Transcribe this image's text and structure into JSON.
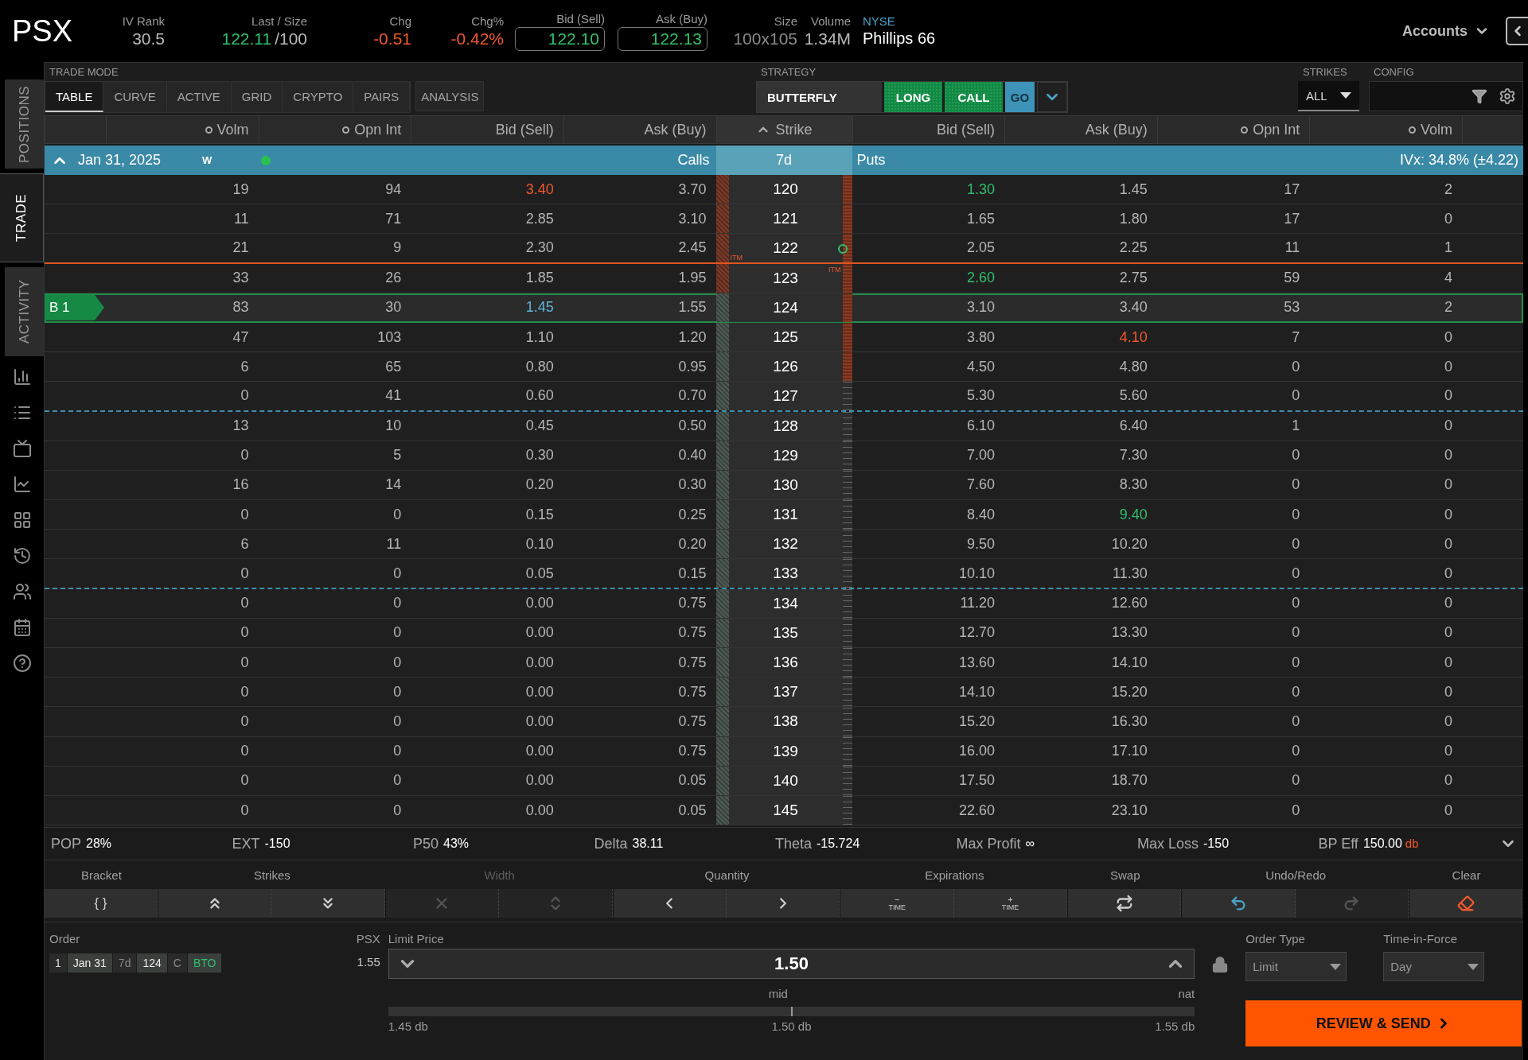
{
  "header": {
    "symbol": "PSX",
    "quotes": [
      {
        "label": "IV Rank",
        "value": "30.5",
        "color": "#b8b8b8",
        "kind": "plain"
      },
      {
        "label": "Last / Size",
        "value": "122.11",
        "suffix": "/100",
        "color": "#2fbf6c",
        "kind": "plain"
      },
      {
        "label": "Chg",
        "value": "-0.51",
        "color": "#f0582e",
        "kind": "plain"
      },
      {
        "label": "Chg%",
        "value": "-0.42%",
        "color": "#f0582e",
        "kind": "plain"
      },
      {
        "label": "Bid (Sell)",
        "value": "122.10",
        "color": "#2fbf6c",
        "kind": "boxed"
      },
      {
        "label": "Ask (Buy)",
        "value": "122.13",
        "color": "#2fbf6c",
        "kind": "boxed"
      },
      {
        "label": "Size",
        "value": "100x105",
        "color": "#8a8a8a",
        "kind": "plain"
      },
      {
        "label": "Volume",
        "value": "1.34M",
        "color": "#b8b8b8",
        "kind": "plain"
      }
    ],
    "exchange": "NYSE",
    "company": "Phillips 66",
    "accounts": "Accounts"
  },
  "sidebar": {
    "tabs": [
      {
        "label": "POSITIONS",
        "selected": false
      },
      {
        "label": "TRADE",
        "selected": true
      },
      {
        "label": "ACTIVITY",
        "selected": false
      }
    ],
    "tools": [
      {
        "kind": "report"
      },
      {
        "kind": "list"
      },
      {
        "kind": "tv"
      },
      {
        "kind": "chart"
      },
      {
        "kind": "grid"
      },
      {
        "kind": "history"
      },
      {
        "kind": "people"
      },
      {
        "kind": "calendar"
      },
      {
        "kind": "help"
      }
    ]
  },
  "trade_mode": {
    "label": "TRADE MODE",
    "tabs": [
      {
        "label": "TABLE",
        "selected": true
      },
      {
        "label": "CURVE",
        "selected": false
      },
      {
        "label": "ACTIVE",
        "selected": false
      },
      {
        "label": "GRID",
        "selected": false
      },
      {
        "label": "CRYPTO",
        "selected": false
      },
      {
        "label": "PAIRS",
        "selected": false
      }
    ],
    "analysis": "ANALYSIS"
  },
  "strategy": {
    "label": "STRATEGY",
    "name": "BUTTERFLY",
    "direction": "LONG",
    "type": "CALL",
    "go": "GO"
  },
  "strikes": {
    "label": "STRIKES",
    "value": "ALL"
  },
  "config": {
    "label": "CONFIG"
  },
  "columns": {
    "calls": [
      {
        "label": "Volm",
        "kind": "toggle"
      },
      {
        "label": "Opn Int",
        "kind": "toggle"
      },
      {
        "label": "Bid (Sell)",
        "kind": "plain"
      },
      {
        "label": "Ask (Buy)",
        "kind": "plain"
      }
    ],
    "strike": "Strike",
    "puts": [
      {
        "label": "Bid (Sell)",
        "kind": "plain"
      },
      {
        "label": "Ask (Buy)",
        "kind": "plain"
      },
      {
        "label": "Opn Int",
        "kind": "toggle"
      },
      {
        "label": "Volm",
        "kind": "toggle"
      }
    ]
  },
  "expiry": {
    "date": "Jan 31, 2025",
    "tag": "W",
    "expanded": true,
    "calls": "Calls",
    "days": "7d",
    "puts": "Puts",
    "ivx": "IVx: 34.8% (±4.22)"
  },
  "rows": [
    {
      "strike": "120",
      "call": [
        "19",
        "94",
        {
          "value": "3.40",
          "color": "#f0582e"
        },
        "3.70"
      ],
      "put": [
        {
          "value": "1.30",
          "color": "#2fbf6c"
        },
        "1.45",
        "17",
        "2"
      ],
      "call_itm": true,
      "put_bar": true,
      "selected": false
    },
    {
      "strike": "121",
      "call": [
        "11",
        "71",
        "2.85",
        "3.10"
      ],
      "put": [
        "1.65",
        "1.80",
        "17",
        "0"
      ],
      "call_itm": true,
      "put_bar": true,
      "selected": false
    },
    {
      "strike": "122",
      "call": [
        "21",
        "9",
        "2.30",
        "2.45"
      ],
      "put": [
        "2.05",
        "2.25",
        "11",
        "1"
      ],
      "call_itm": true,
      "put_bar": true,
      "selected": false,
      "itm_line_below": true,
      "call_itm_label": "ITM",
      "marker": true
    },
    {
      "strike": "123",
      "call": [
        "33",
        "26",
        "1.85",
        "1.95"
      ],
      "put": [
        {
          "value": "2.60",
          "color": "#2fbf6c"
        },
        "2.75",
        "59",
        "4"
      ],
      "call_itm": true,
      "put_bar": true,
      "selected": false,
      "put_itm_label": "ITM"
    },
    {
      "strike": "124",
      "call": [
        "83",
        "30",
        {
          "value": "1.45",
          "color": "#5fb4d6"
        },
        "1.55"
      ],
      "put": [
        "3.10",
        "3.40",
        "53",
        "2"
      ],
      "call_itm": false,
      "put_bar": true,
      "selected": true,
      "position": "B 1"
    },
    {
      "strike": "125",
      "call": [
        "47",
        "103",
        "1.10",
        "1.20"
      ],
      "put": [
        "3.80",
        {
          "value": "4.10",
          "color": "#f0582e"
        },
        "7",
        "0"
      ],
      "call_itm": false,
      "put_bar": true,
      "selected": false
    },
    {
      "strike": "126",
      "call": [
        "6",
        "65",
        "0.80",
        "0.95"
      ],
      "put": [
        "4.50",
        "4.80",
        "0",
        "0"
      ],
      "call_itm": false,
      "put_bar": true,
      "selected": false
    },
    {
      "strike": "127",
      "call": [
        "0",
        "41",
        "0.60",
        "0.70"
      ],
      "put": [
        "5.30",
        "5.60",
        "0",
        "0"
      ],
      "call_itm": false,
      "put_bar": false,
      "selected": false,
      "dashed_below": true
    },
    {
      "strike": "128",
      "call": [
        "13",
        "10",
        "0.45",
        "0.50"
      ],
      "put": [
        "6.10",
        "6.40",
        "1",
        "0"
      ],
      "call_itm": false,
      "put_bar": false,
      "selected": false
    },
    {
      "strike": "129",
      "call": [
        "0",
        "5",
        "0.30",
        "0.40"
      ],
      "put": [
        "7.00",
        "7.30",
        "0",
        "0"
      ],
      "call_itm": false,
      "put_bar": false,
      "selected": false
    },
    {
      "strike": "130",
      "call": [
        "16",
        "14",
        "0.20",
        "0.30"
      ],
      "put": [
        "7.60",
        "8.30",
        "0",
        "0"
      ],
      "call_itm": false,
      "put_bar": false,
      "selected": false
    },
    {
      "strike": "131",
      "call": [
        "0",
        "0",
        "0.15",
        "0.25"
      ],
      "put": [
        "8.40",
        {
          "value": "9.40",
          "color": "#2fbf6c"
        },
        "0",
        "0"
      ],
      "call_itm": false,
      "put_bar": false,
      "selected": false
    },
    {
      "strike": "132",
      "call": [
        "6",
        "11",
        "0.10",
        "0.20"
      ],
      "put": [
        "9.50",
        "10.20",
        "0",
        "0"
      ],
      "call_itm": false,
      "put_bar": false,
      "selected": false
    },
    {
      "strike": "133",
      "call": [
        "0",
        "0",
        "0.05",
        "0.15"
      ],
      "put": [
        "10.10",
        "11.30",
        "0",
        "0"
      ],
      "call_itm": false,
      "put_bar": false,
      "selected": false,
      "dashed_below": true
    },
    {
      "strike": "134",
      "call": [
        "0",
        "0",
        "0.00",
        "0.75"
      ],
      "put": [
        "11.20",
        "12.60",
        "0",
        "0"
      ],
      "call_itm": false,
      "put_bar": false,
      "selected": false
    },
    {
      "strike": "135",
      "call": [
        "0",
        "0",
        "0.00",
        "0.75"
      ],
      "put": [
        "12.70",
        "13.30",
        "0",
        "0"
      ],
      "call_itm": false,
      "put_bar": false,
      "selected": false
    },
    {
      "strike": "136",
      "call": [
        "0",
        "0",
        "0.00",
        "0.75"
      ],
      "put": [
        "13.60",
        "14.10",
        "0",
        "0"
      ],
      "call_itm": false,
      "put_bar": false,
      "selected": false
    },
    {
      "strike": "137",
      "call": [
        "0",
        "0",
        "0.00",
        "0.75"
      ],
      "put": [
        "14.10",
        "15.20",
        "0",
        "0"
      ],
      "call_itm": false,
      "put_bar": false,
      "selected": false
    },
    {
      "strike": "138",
      "call": [
        "0",
        "0",
        "0.00",
        "0.75"
      ],
      "put": [
        "15.20",
        "16.30",
        "0",
        "0"
      ],
      "call_itm": false,
      "put_bar": false,
      "selected": false
    },
    {
      "strike": "139",
      "call": [
        "0",
        "0",
        "0.00",
        "0.75"
      ],
      "put": [
        "16.00",
        "17.10",
        "0",
        "0"
      ],
      "call_itm": false,
      "put_bar": false,
      "selected": false
    },
    {
      "strike": "140",
      "call": [
        "0",
        "0",
        "0.00",
        "0.05"
      ],
      "put": [
        "17.50",
        "18.70",
        "0",
        "0"
      ],
      "call_itm": false,
      "put_bar": false,
      "selected": false
    },
    {
      "strike": "145",
      "call": [
        "0",
        "0",
        "0.00",
        "0.05"
      ],
      "put": [
        "22.60",
        "23.10",
        "0",
        "0"
      ],
      "call_itm": false,
      "put_bar": false,
      "selected": false
    }
  ],
  "stats": [
    {
      "label": "POP",
      "value": "28%"
    },
    {
      "label": "EXT",
      "value": "-150"
    },
    {
      "label": "P50",
      "value": "43%"
    },
    {
      "label": "Delta",
      "value": "38.11"
    },
    {
      "label": "Theta",
      "value": "-15.724"
    },
    {
      "label": "Max Profit",
      "value": "∞"
    },
    {
      "label": "Max Loss",
      "value": "-150"
    },
    {
      "label": "BP Eff",
      "value": "150.00",
      "unit": "db"
    }
  ],
  "toolbar": [
    {
      "label": "Bracket",
      "disabled": false,
      "buttons": [
        {
          "kind": "text",
          "text": "{ }",
          "disabled": false
        }
      ]
    },
    {
      "label": "Strikes",
      "disabled": false,
      "buttons": [
        {
          "kind": "up",
          "disabled": false
        },
        {
          "kind": "down",
          "disabled": false
        }
      ]
    },
    {
      "label": "Width",
      "disabled": true,
      "buttons": [
        {
          "kind": "remove",
          "disabled": true
        },
        {
          "kind": "updown",
          "disabled": true
        }
      ]
    },
    {
      "label": "Quantity",
      "disabled": false,
      "buttons": [
        {
          "kind": "less",
          "disabled": false
        },
        {
          "kind": "more",
          "disabled": false
        }
      ]
    },
    {
      "label": "Expirations",
      "disabled": false,
      "buttons": [
        {
          "kind": "time",
          "sign": "−",
          "text": "TIME",
          "disabled": false
        },
        {
          "kind": "time",
          "sign": "+",
          "text": "TIME",
          "disabled": false
        }
      ]
    },
    {
      "label": "Swap",
      "disabled": false,
      "buttons": [
        {
          "kind": "swap",
          "disabled": false
        }
      ]
    },
    {
      "label": "Undo/Redo",
      "disabled": false,
      "buttons": [
        {
          "kind": "undo",
          "disabled": false
        },
        {
          "kind": "redo",
          "disabled": true
        }
      ]
    },
    {
      "label": "Clear",
      "disabled": false,
      "buttons": [
        {
          "kind": "clear",
          "disabled": false
        }
      ]
    }
  ],
  "order": {
    "label": "Order",
    "legs": [
      {
        "text": "1",
        "kind": "plain"
      },
      {
        "text": "Jan 31",
        "kind": "strong"
      },
      {
        "text": "7d",
        "kind": "dim"
      },
      {
        "text": "124",
        "kind": "strong"
      },
      {
        "text": "C",
        "kind": "dim"
      },
      {
        "text": "BTO",
        "kind": "action"
      }
    ],
    "symbol": "PSX",
    "price": "1.55",
    "limit_label": "Limit Price",
    "limit_value": "1.50",
    "slider": {
      "level": 0.5,
      "above": [
        "mid",
        "nat"
      ],
      "below": [
        "1.45 db",
        "1.50 db",
        "1.55 db"
      ]
    },
    "order_type_label": "Order Type",
    "order_type": "Limit",
    "tif_label": "Time-in-Force",
    "tif": "Day",
    "submit": "REVIEW & SEND"
  }
}
